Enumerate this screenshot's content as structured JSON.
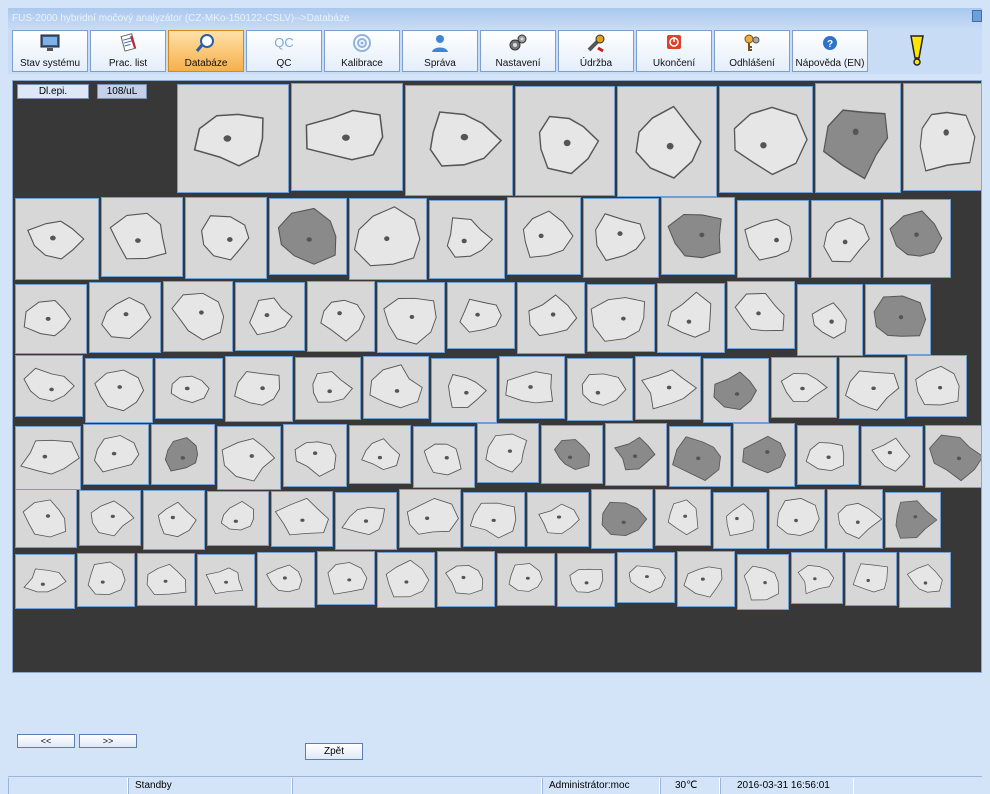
{
  "window": {
    "title": "FUS-2000 hybridní močový analyzátor (CZ-MKo-150122-CSLV)-->Databáze"
  },
  "toolbar": {
    "buttons": [
      {
        "id": "stav",
        "label": "Stav systému",
        "icon": "monitor-icon"
      },
      {
        "id": "prac",
        "label": "Prac. list",
        "icon": "worklist-icon"
      },
      {
        "id": "databaze",
        "label": "Databáze",
        "icon": "magnifier-icon",
        "active": true
      },
      {
        "id": "qc",
        "label": "QC",
        "icon": "qc-icon"
      },
      {
        "id": "kalibrace",
        "label": "Kalibrace",
        "icon": "target-icon"
      },
      {
        "id": "sprava",
        "label": "Správa",
        "icon": "user-icon"
      },
      {
        "id": "nastaveni",
        "label": "Nastavení",
        "icon": "gears-icon"
      },
      {
        "id": "udrzba",
        "label": "Údržba",
        "icon": "wrench-icon"
      },
      {
        "id": "ukonceni",
        "label": "Ukončení",
        "icon": "power-icon"
      },
      {
        "id": "odhlaseni",
        "label": "Odhlášení",
        "icon": "keys-icon"
      },
      {
        "id": "napoveda",
        "label": "Nápověda (EN)",
        "icon": "help-icon"
      }
    ],
    "qc_icon_text": "QC"
  },
  "gallery": {
    "cell_type_label": "Dl.epi.",
    "concentration_label": "108/uL",
    "image_counts_per_row": [
      8,
      12,
      13,
      14,
      15,
      15,
      16
    ]
  },
  "navigation": {
    "prev_label": "<<",
    "next_label": ">>",
    "back_label": "Zpět"
  },
  "status_bar": {
    "state": "Standby",
    "user": "Administrátor:moc",
    "temperature": "30℃",
    "datetime": "2016-03-31 16:56:01"
  },
  "colors": {
    "active_tab": "#f5b04b",
    "gallery_bg": "#383838",
    "cell_border": "#6f9fd4",
    "warning": "#ffe600"
  }
}
